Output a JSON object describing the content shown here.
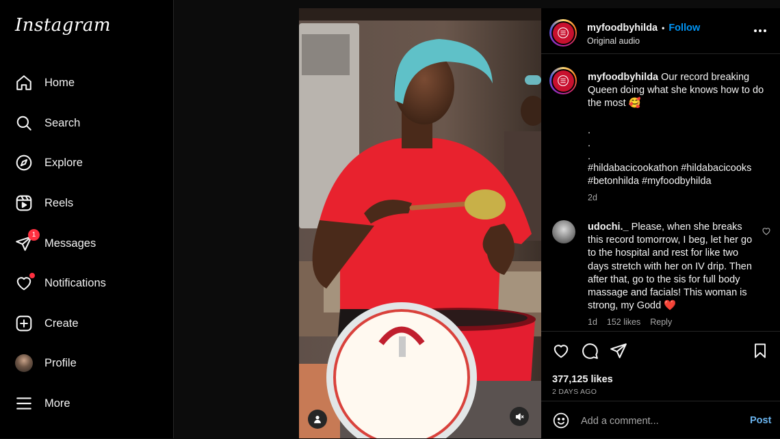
{
  "app": {
    "logo": "Instagram"
  },
  "nav": [
    {
      "id": "home",
      "label": "Home",
      "icon": "home-icon"
    },
    {
      "id": "search",
      "label": "Search",
      "icon": "search-icon"
    },
    {
      "id": "explore",
      "label": "Explore",
      "icon": "compass-icon"
    },
    {
      "id": "reels",
      "label": "Reels",
      "icon": "reels-icon"
    },
    {
      "id": "messages",
      "label": "Messages",
      "icon": "paper-plane-icon",
      "badge": "1"
    },
    {
      "id": "notifications",
      "label": "Notifications",
      "icon": "heart-icon"
    },
    {
      "id": "create",
      "label": "Create",
      "icon": "plus-square-icon"
    },
    {
      "id": "profile",
      "label": "Profile",
      "icon": "avatar"
    },
    {
      "id": "more",
      "label": "More",
      "icon": "hamburger-icon"
    }
  ],
  "post": {
    "author": "myfoodbyhilda",
    "separator": "•",
    "follow_label": "Follow",
    "audio": "Original audio",
    "caption_user": "myfoodbyhilda",
    "caption_text": "Our record breaking Queen doing what she knows how to do the most 🥰",
    "caption_dots": [
      ".",
      ".",
      "."
    ],
    "hashtags": "#hildabacicookathon #hildabacicooks #betonhilda #myfoodbyhilda",
    "caption_age": "2d",
    "likes": "377,125 likes",
    "date": "2 DAYS AGO"
  },
  "comment": {
    "user": "udochi._",
    "text": "Please, when she breaks this record tomorrow, I beg, let her go to the hospital and rest for like two days stretch with her on IV drip. Then after that, go to the sis for full body massage and facials! This woman is strong, my Godd ❤️",
    "age": "1d",
    "likes": "152 likes",
    "reply_label": "Reply"
  },
  "add_comment": {
    "placeholder": "Add a comment...",
    "post_label": "Post"
  },
  "colors": {
    "accent": "#0095f6",
    "badge": "#ff3040",
    "background": "#000000",
    "apron": "#e8222e"
  }
}
